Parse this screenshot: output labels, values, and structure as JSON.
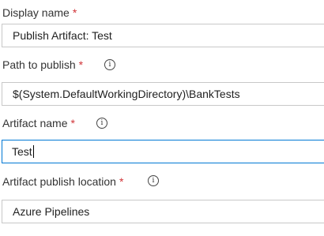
{
  "form": {
    "display_name": {
      "label": "Display name",
      "required_mark": "*",
      "value": "Publish Artifact: Test"
    },
    "path_to_publish": {
      "label": "Path to publish",
      "required_mark": "*",
      "info_icon": "info-icon",
      "value": "$(System.DefaultWorkingDirectory)\\BankTests"
    },
    "artifact_name": {
      "label": "Artifact name",
      "required_mark": "*",
      "info_icon": "info-icon",
      "value": "Test",
      "focused": true
    },
    "artifact_publish_location": {
      "label": "Artifact publish location",
      "required_mark": "*",
      "info_icon": "info-icon",
      "value": "Azure Pipelines"
    }
  },
  "colors": {
    "required": "#d13438",
    "focus_border": "#0078d4",
    "field_border": "#c8c8c8",
    "text": "#333333"
  }
}
